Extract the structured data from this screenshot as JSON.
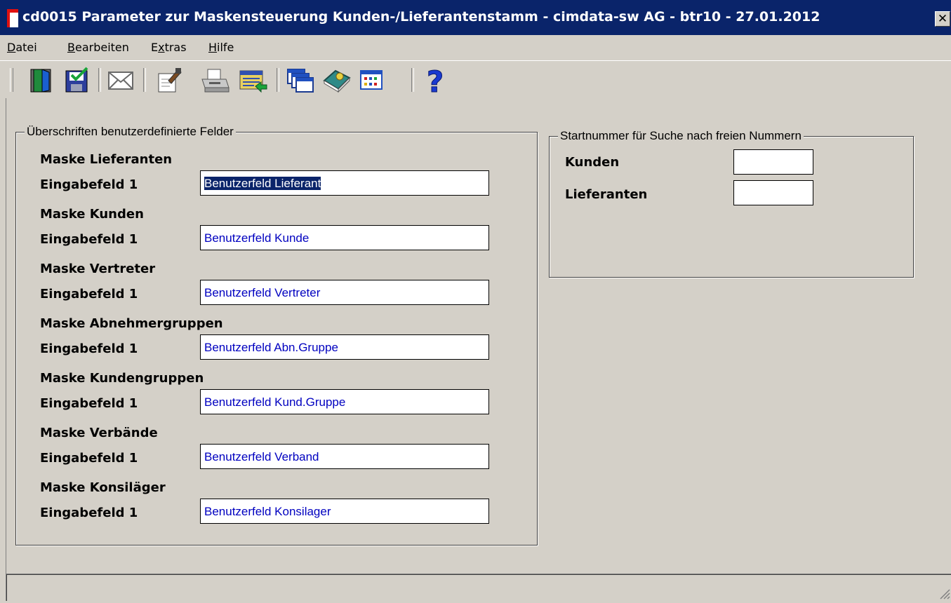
{
  "window": {
    "title": "cd0015 Parameter zur Maskensteuerung Kunden-/Lieferantenstamm - cimdata-sw AG - btr10 - 27.01.2012",
    "close_symbol": "✕"
  },
  "menu": [
    {
      "accel": "D",
      "rest": "atei"
    },
    {
      "accel": "B",
      "rest": "earbeiten"
    },
    {
      "pre": "E",
      "accel": "x",
      "rest": "tras"
    },
    {
      "accel": "H",
      "rest": "ilfe"
    }
  ],
  "toolbar": {
    "icons": [
      "exit-door-icon",
      "save-icon",
      "mail-icon",
      "edit-properties-icon",
      "print-icon",
      "list-export-icon",
      "windows-icon",
      "book-icon",
      "table-icon",
      "help-icon"
    ],
    "help_glyph": "?"
  },
  "colors": {
    "titlebar": "#0a246a",
    "face": "#d4d0c8",
    "input_text": "#0000c0",
    "selection": "#0a246a"
  },
  "user_fields": {
    "legend": "Überschriften benutzerdefinierte Felder",
    "sections": [
      {
        "heading": "Maske Lieferanten",
        "label": "Eingabefeld 1",
        "value": "Benutzerfeld Lieferant"
      },
      {
        "heading": "Maske Kunden",
        "label": "Eingabefeld 1",
        "value": "Benutzerfeld Kunde"
      },
      {
        "heading": "Maske Vertreter",
        "label": "Eingabefeld 1",
        "value": "Benutzerfeld Vertreter"
      },
      {
        "heading": "Maske Abnehmergruppen",
        "label": "Eingabefeld 1",
        "value": "Benutzerfeld Abn.Gruppe"
      },
      {
        "heading": "Maske Kundengruppen",
        "label": "Eingabefeld 1",
        "value": "Benutzerfeld Kund.Gruppe"
      },
      {
        "heading": "Maske Verbände",
        "label": "Eingabefeld 1",
        "value": "Benutzerfeld Verband"
      },
      {
        "heading": "Maske Konsiläger",
        "label": "Eingabefeld 1",
        "value": "Benutzerfeld Konsilager"
      }
    ]
  },
  "start_numbers": {
    "legend": "Startnummer für Suche nach freien Nummern",
    "kunden_label": "Kunden",
    "kunden_value": "",
    "lieferanten_label": "Lieferanten",
    "lieferanten_value": ""
  },
  "status": {
    "text": ""
  }
}
